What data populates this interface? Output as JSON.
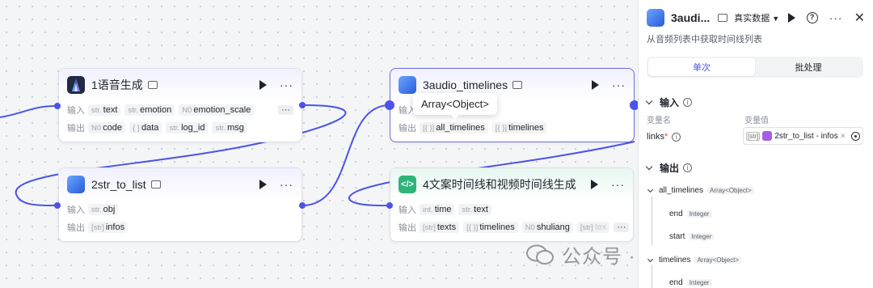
{
  "canvas": {
    "nodes": [
      {
        "title": "1语音生成",
        "input_label": "输入",
        "output_label": "输出",
        "inputs": [
          {
            "type": "str.",
            "name": "text"
          },
          {
            "type": "str.",
            "name": "emotion"
          },
          {
            "type": "N0",
            "name": "emotion_scale"
          }
        ],
        "more": "···",
        "outputs": [
          {
            "type": "N0",
            "name": "code"
          },
          {
            "type": "{ }",
            "name": "data"
          },
          {
            "type": "str.",
            "name": "log_id"
          },
          {
            "type": "str.",
            "name": "msg"
          }
        ]
      },
      {
        "title": "2str_to_list",
        "input_label": "输入",
        "output_label": "输出",
        "inputs": [
          {
            "type": "str.",
            "name": "obj"
          }
        ],
        "outputs": [
          {
            "type": "[str]",
            "name": "infos"
          }
        ]
      },
      {
        "title": "3audio_timelines",
        "input_label": "输入",
        "output_label": "输出",
        "outputs": [
          {
            "type": "[{ }]",
            "name": "all_timelines"
          },
          {
            "type": "[{ }]",
            "name": "timelines"
          }
        ]
      },
      {
        "title": "4文案时间线和视频时间线生成",
        "input_label": "输入",
        "output_label": "输出",
        "inputs": [
          {
            "type": "int.",
            "name": "time"
          },
          {
            "type": "str.",
            "name": "text"
          }
        ],
        "outputs": [
          {
            "type": "[str]",
            "name": "texts"
          },
          {
            "type": "[{ }]",
            "name": "timelines"
          },
          {
            "type": "N0",
            "name": "shuliang"
          },
          {
            "type": "[str]",
            "name": "tex"
          }
        ],
        "more": "···"
      }
    ],
    "tooltip": "Array<Object>",
    "edge_color": "#4d53e8"
  },
  "panel": {
    "title": "3audi...",
    "mode": "真实数据",
    "description": "从音频列表中获取时间线列表",
    "tabs": [
      "单次",
      "批处理"
    ],
    "input_section": "输入",
    "col_name": "变量名",
    "col_value": "变量值",
    "param_name": "links",
    "param_required": "*",
    "param_type_badge": "[str]",
    "param_value": "2str_to_list - infos",
    "param_clear": "×",
    "output_section": "输出",
    "outputs": [
      {
        "name": "all_timelines",
        "type": "Array<Object>"
      },
      {
        "name": "end",
        "type": "Integer"
      },
      {
        "name": "start",
        "type": "Integer"
      },
      {
        "name": "timelines",
        "type": "Array<Object>"
      },
      {
        "name": "end",
        "type": "Integer"
      }
    ]
  },
  "watermark": "公众号 · 杰克船长的AIGC"
}
